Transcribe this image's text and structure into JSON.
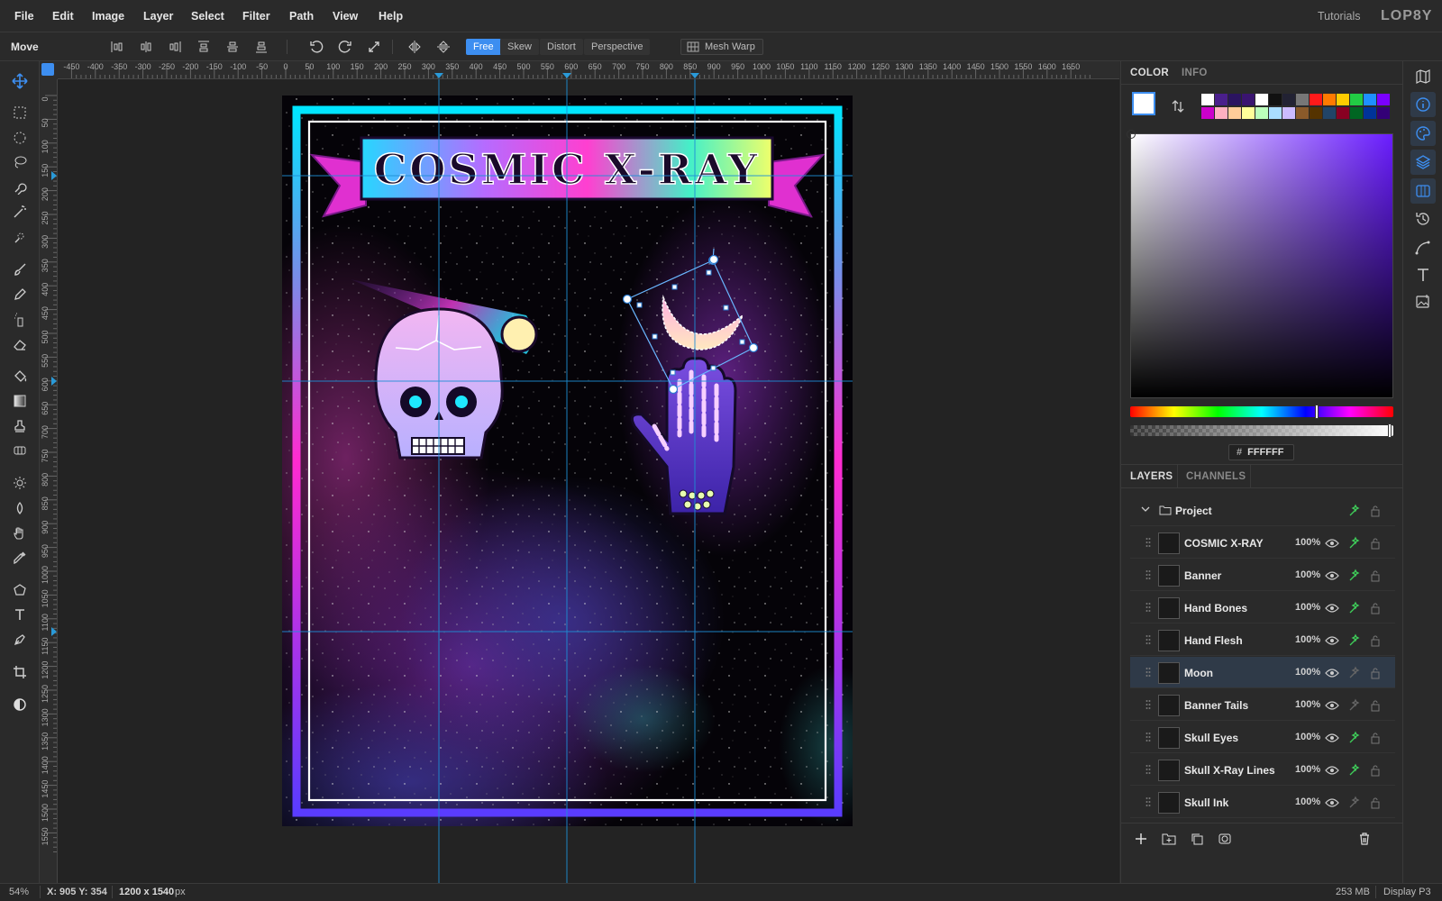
{
  "menu": [
    "File",
    "Edit",
    "Image",
    "Layer",
    "Select",
    "Filter",
    "Path",
    "View",
    "Help"
  ],
  "menu_right": {
    "tutorials": "Tutorials",
    "logo": "LOP8Y"
  },
  "options": {
    "tool_name": "Move",
    "modes": [
      "Free",
      "Skew",
      "Distort",
      "Perspective"
    ],
    "active_mode": "Free",
    "mesh_warp": "Mesh Warp"
  },
  "ruler_top": [
    "-450",
    "-400",
    "-350",
    "-300",
    "-250",
    "-200",
    "-150",
    "-100",
    "-50",
    "0",
    "50",
    "100",
    "150",
    "200",
    "250",
    "300",
    "350",
    "400",
    "450",
    "500",
    "550",
    "600",
    "650",
    "700",
    "750",
    "800",
    "850",
    "900",
    "950",
    "1000",
    "1050",
    "1100",
    "1150",
    "1200",
    "1250",
    "1300",
    "1350",
    "1400",
    "1450",
    "1500",
    "1550",
    "1600",
    "1650"
  ],
  "ruler_left": [
    "0",
    "50",
    "100",
    "150",
    "200",
    "250",
    "300",
    "350",
    "400",
    "450",
    "500",
    "550",
    "600",
    "650",
    "700",
    "750",
    "800",
    "850",
    "900",
    "950",
    "1000",
    "1050",
    "1100",
    "1150",
    "1200",
    "1250",
    "1300",
    "1350",
    "1400",
    "1450",
    "1500",
    "1550"
  ],
  "artwork": {
    "title": "COSMIC X-RAY"
  },
  "color_panel": {
    "tabs": [
      "COLOR",
      "INFO"
    ],
    "hex_prefix": "#",
    "hex": "FFFFFF",
    "primary": "#ffffff",
    "accent": "#3d8ef0",
    "swatches": [
      "#ffffff",
      "#4a1f8c",
      "#2b1460",
      "#3a1470",
      "#ffffff",
      "#111111",
      "#222233",
      "#777777",
      "#ff1a1a",
      "#ff7a00",
      "#ffcc00",
      "#22cc44",
      "#1e90ff",
      "#7a00ff",
      "#cc00cc",
      "#ffb0c0",
      "#ffcc99",
      "#ffff99",
      "#bbffbb",
      "#aaddff",
      "#ccbbff",
      "#8a5a2a",
      "#553300",
      "#224466",
      "#880022",
      "#006622",
      "#003399",
      "#330077"
    ]
  },
  "layers_panel": {
    "tabs": [
      "LAYERS",
      "CHANNELS"
    ],
    "group": "Project",
    "layers": [
      {
        "name": "COSMIC X-RAY",
        "opacity": "100%",
        "selected": false,
        "eye": true,
        "fx": true
      },
      {
        "name": "Banner",
        "opacity": "100%",
        "selected": false,
        "eye": true,
        "fx": true
      },
      {
        "name": "Hand Bones",
        "opacity": "100%",
        "selected": false,
        "eye": true,
        "fx": true
      },
      {
        "name": "Hand Flesh",
        "opacity": "100%",
        "selected": false,
        "eye": true,
        "fx": true
      },
      {
        "name": "Moon",
        "opacity": "100%",
        "selected": true,
        "eye": true,
        "fx": false
      },
      {
        "name": "Banner Tails",
        "opacity": "100%",
        "selected": false,
        "eye": true,
        "fx": false
      },
      {
        "name": "Skull Eyes",
        "opacity": "100%",
        "selected": false,
        "eye": true,
        "fx": true
      },
      {
        "name": "Skull X-Ray Lines",
        "opacity": "100%",
        "selected": false,
        "eye": true,
        "fx": true
      },
      {
        "name": "Skull Ink",
        "opacity": "100%",
        "selected": false,
        "eye": true,
        "fx": false
      }
    ]
  },
  "status": {
    "zoom": "54%",
    "coords": "X: 905 Y: 354",
    "dims_value": "1200 x 1540",
    "dims_unit": "px",
    "memory": "253 MB",
    "display": "Display P3"
  }
}
